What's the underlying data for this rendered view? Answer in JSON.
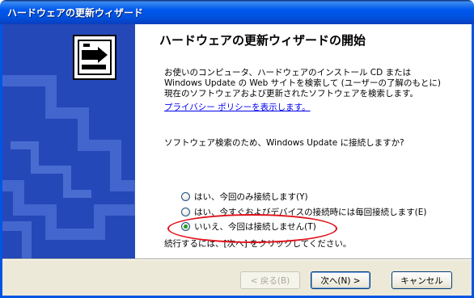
{
  "window": {
    "title": "ハードウェアの更新ウィザード"
  },
  "main": {
    "heading": "ハードウェアの更新ウィザードの開始",
    "intro_text": "お使いのコンピュータ、ハードウェアのインストール CD または Windows Update の Web サイトを検索して (ユーザーの了解のもとに) 現在のソフトウェアおよび更新されたソフトウェアを検索します。",
    "privacy_link": "プライバシー ポリシーを表示します。",
    "question": "ソフトウェア検索のため、Windows Update に接続しますか?",
    "options": [
      {
        "label": "はい、今回のみ接続します(Y)",
        "selected": false
      },
      {
        "label": "はい、今すぐおよびデバイスの接続時には毎回接続します(E)",
        "selected": false
      },
      {
        "label": "いいえ、今回は接続しません(T)",
        "selected": true
      }
    ],
    "continue_text": "続行するには、[次へ] をクリックしてください。"
  },
  "buttons": {
    "back": "< 戻る(B)",
    "next": "次へ(N) >",
    "cancel": "キャンセル"
  },
  "colors": {
    "titlebar": "#0058ee",
    "side_panel": "#2448b8",
    "annotation": "#e0101a",
    "selected_radio": "#21a121"
  }
}
